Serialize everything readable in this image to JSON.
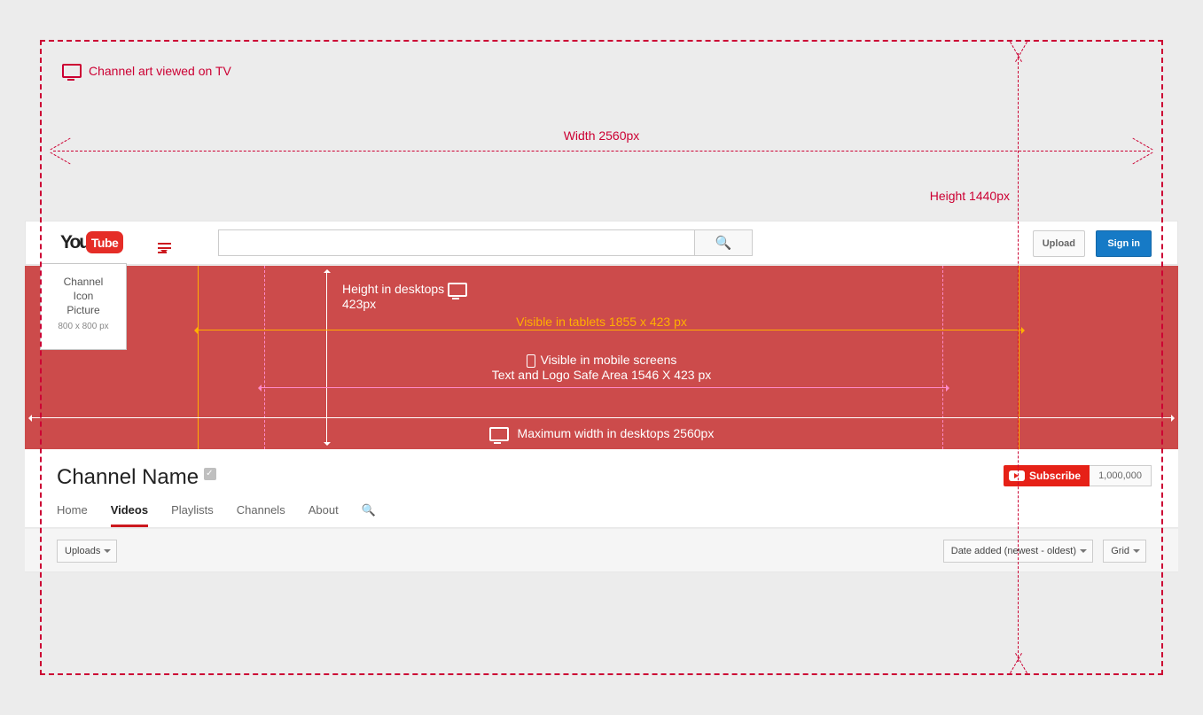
{
  "tv": {
    "label": "Channel art viewed on TV",
    "width_label": "Width  2560px",
    "height_label": "Height   1440px"
  },
  "header": {
    "upload": "Upload",
    "signin": "Sign in"
  },
  "icon": {
    "l1": "Channel",
    "l2": "Icon",
    "l3": "Picture",
    "dim": "800 x 800 px"
  },
  "art": {
    "desk_h_1": "Height in desktops",
    "desk_h_2": "423px",
    "tablet": "Visible in tablets  1855 x 423 px",
    "mobile_l1": "Visible in mobile screens",
    "mobile_l2": "Text and Logo Safe Area   1546 X 423 px",
    "desk_w": "Maximum width in desktops  2560px"
  },
  "channel": {
    "name": "Channel Name",
    "sub_label": "Subscribe",
    "sub_count": "1,000,000",
    "tabs": [
      "Home",
      "Videos",
      "Playlists",
      "Channels",
      "About"
    ]
  },
  "toolbar": {
    "uploads": "Uploads",
    "sort": "Date added (newest - oldest)",
    "view": "Grid"
  }
}
